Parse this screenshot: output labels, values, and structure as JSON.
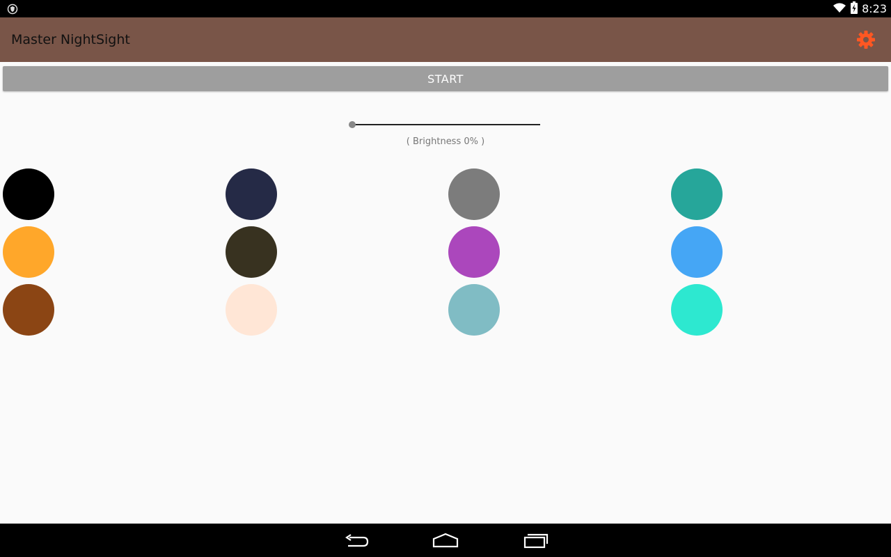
{
  "status_bar": {
    "time": "8:23",
    "left_icon": "shield-icon",
    "wifi_icon": "wifi-icon",
    "battery_icon": "battery-charging-icon"
  },
  "app_bar": {
    "title": "Master NightSight",
    "settings_icon": "gear-icon",
    "background_color": "#795548",
    "settings_color": "#ff5722"
  },
  "start_button": {
    "label": "START",
    "background_color": "#9e9e9e"
  },
  "brightness": {
    "value_percent": 0,
    "label": "( Brightness 0% )"
  },
  "color_swatches": [
    [
      "#000000",
      "#252a46",
      "#7c7c7c",
      "#26a69a"
    ],
    [
      "#ffa72a",
      "#383220",
      "#ab47bc",
      "#45a6f5"
    ],
    [
      "#8b4514",
      "#ffe6d6",
      "#80bcc4",
      "#2de8d0"
    ]
  ],
  "nav_bar": {
    "back_icon": "back-icon",
    "home_icon": "home-icon",
    "recents_icon": "recents-icon"
  }
}
